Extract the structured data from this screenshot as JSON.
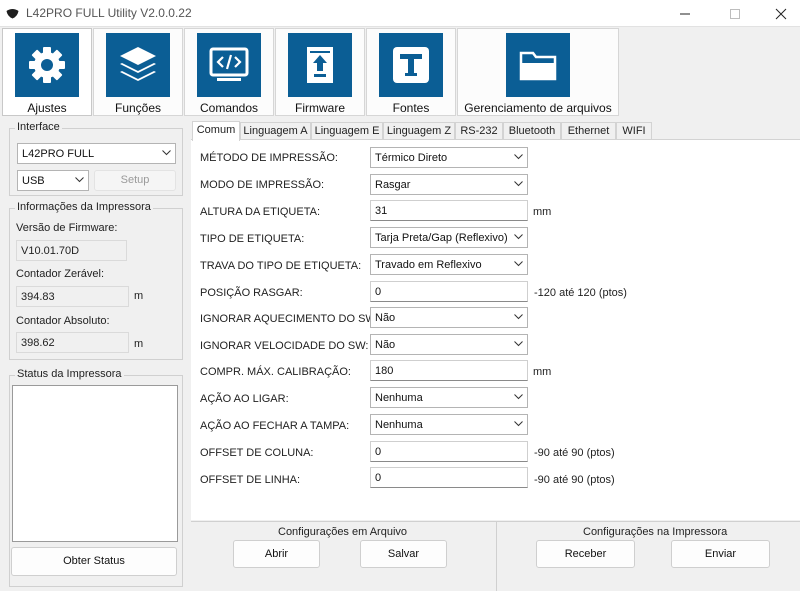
{
  "window": {
    "title": "L42PRO FULL Utility  V2.0.0.22",
    "icon": "app-shield-icon"
  },
  "toolbar": {
    "items": [
      {
        "label": "Ajustes",
        "icon": "gear-icon",
        "active": true
      },
      {
        "label": "Funções",
        "icon": "layers-icon",
        "active": false
      },
      {
        "label": "Comandos",
        "icon": "code-icon",
        "active": false
      },
      {
        "label": "Firmware",
        "icon": "upload-icon",
        "active": false
      },
      {
        "label": "Fontes",
        "icon": "font-icon",
        "active": false
      },
      {
        "label": "Gerenciamento de arquivos",
        "icon": "folder-icon",
        "active": false
      }
    ],
    "accent": "#0b5e95"
  },
  "interface": {
    "title": "Interface",
    "printer": "L42PRO FULL",
    "port": "USB",
    "setup_label": "Setup"
  },
  "info": {
    "title": "Informações da Impressora",
    "firmware_label": "Versão de Firmware:",
    "firmware_value": "V10.01.70D",
    "resettable_label": "Contador Zerável:",
    "resettable_value": "394.83",
    "resettable_unit": "m",
    "absolute_label": "Contador Absoluto:",
    "absolute_value": "398.62",
    "absolute_unit": "m"
  },
  "status": {
    "title": "Status da Impressora",
    "button_label": "Obter Status"
  },
  "tabs": [
    "Comum",
    "Linguagem A",
    "Linguagem E",
    "Linguagem Z",
    "RS-232",
    "Bluetooth",
    "Ethernet",
    "WIFI"
  ],
  "settings": [
    {
      "label": "MÉTODO DE IMPRESSÃO:",
      "type": "combo",
      "value": "Térmico Direto",
      "suffix": ""
    },
    {
      "label": "MODO DE IMPRESSÃO:",
      "type": "combo",
      "value": "Rasgar",
      "suffix": ""
    },
    {
      "label": "ALTURA DA ETIQUETA:",
      "type": "text",
      "value": "31",
      "suffix": "mm"
    },
    {
      "label": "TIPO DE ETIQUETA:",
      "type": "combo",
      "value": "Tarja Preta/Gap (Reflexivo)",
      "suffix": ""
    },
    {
      "label": "TRAVA DO TIPO DE ETIQUETA:",
      "type": "combo",
      "value": "Travado em Reflexivo",
      "suffix": ""
    },
    {
      "label": "POSIÇÃO RASGAR:",
      "type": "text",
      "value": "0",
      "suffix": "-120 até 120 (ptos)"
    },
    {
      "label": "IGNORAR AQUECIMENTO DO SW:",
      "type": "combo",
      "value": "Não",
      "suffix": ""
    },
    {
      "label": "IGNORAR VELOCIDADE DO SW:",
      "type": "combo",
      "value": "Não",
      "suffix": ""
    },
    {
      "label": "COMPR. MÁX. CALIBRAÇÃO:",
      "type": "text",
      "value": "180",
      "suffix": "mm"
    },
    {
      "label": "AÇÃO AO LIGAR:",
      "type": "combo",
      "value": "Nenhuma",
      "suffix": ""
    },
    {
      "label": "AÇÃO AO FECHAR A TAMPA:",
      "type": "combo",
      "value": "Nenhuma",
      "suffix": ""
    },
    {
      "label": "OFFSET DE COLUNA:",
      "type": "text",
      "value": "0",
      "suffix": "-90 até 90 (ptos)"
    },
    {
      "label": "OFFSET DE LINHA:",
      "type": "text",
      "value": "0",
      "suffix": "-90 até 90 (ptos)"
    }
  ],
  "file_config": {
    "title": "Configurações em Arquivo",
    "open_label": "Abrir",
    "save_label": "Salvar"
  },
  "printer_config": {
    "title": "Configurações na Impressora",
    "receive_label": "Receber",
    "send_label": "Enviar"
  }
}
